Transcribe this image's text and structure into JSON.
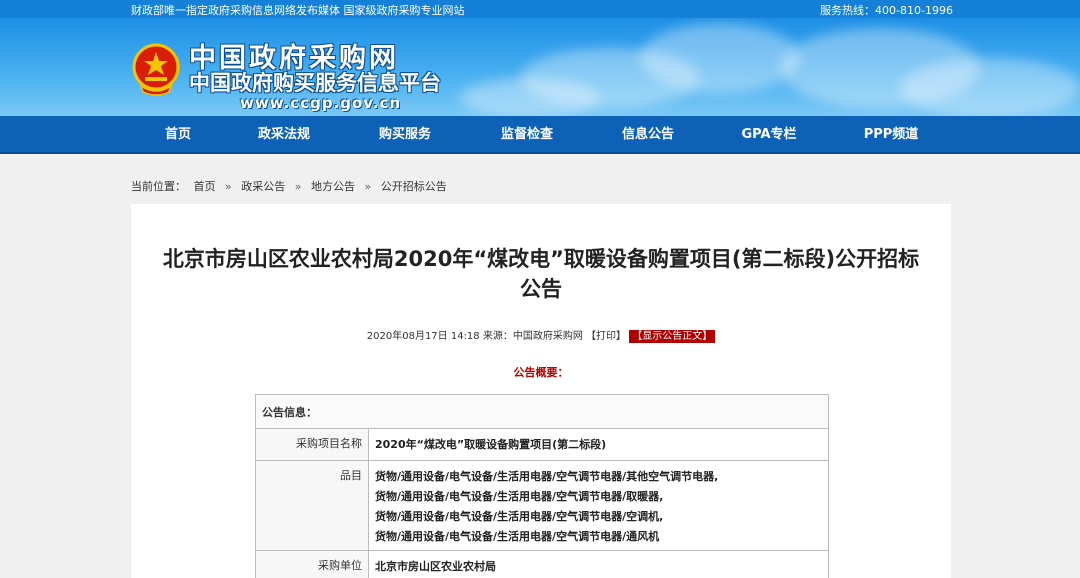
{
  "topbar": {
    "left_text": "财政部唯一指定政府采购信息网络发布媒体  国家级政府采购专业网站",
    "hotline": "服务热线：400-810-1996"
  },
  "header": {
    "title": "中国政府采购网",
    "subtitle": "中国政府购买服务信息平台",
    "url": "www.ccgp.gov.cn"
  },
  "nav": {
    "items": [
      "首页",
      "政采法规",
      "购买服务",
      "监督检查",
      "信息公告",
      "GPA专栏",
      "PPP频道"
    ]
  },
  "breadcrumb": {
    "label": "当前位置：",
    "items": [
      "首页",
      "政采公告",
      "地方公告",
      "公开招标公告"
    ],
    "separator": "»"
  },
  "article": {
    "title_line1": "北京市房山区农业农村局2020年“煤改电”取暖设备购置项目(第二标段)公开招标",
    "title_line2": "公告",
    "date": "2020年08月17日  14:18",
    "source": "来源：中国政府采购网",
    "print": "【打印】",
    "show_text": "【显示公告正文】",
    "summary_heading": "公告概要："
  },
  "info_table": {
    "heading": "公告信息：",
    "rows": [
      {
        "label": "采购项目名称",
        "value": "2020年“煤改电”取暖设备购置项目(第二标段)"
      },
      {
        "label": "品目",
        "values": [
          "货物/通用设备/电气设备/生活用电器/空气调节电器/其他空气调节电器,",
          "货物/通用设备/电气设备/生活用电器/空气调节电器/取暖器,",
          "货物/通用设备/电气设备/生活用电器/空气调节电器/空调机,",
          "货物/通用设备/电气设备/生活用电器/空气调节电器/通风机"
        ]
      },
      {
        "label": "采购单位",
        "value": "北京市房山区农业农村局"
      }
    ]
  },
  "colors": {
    "nav_bg": "#0d62b8",
    "accent_red": "#b00000",
    "header_blue": "#1d8fe6"
  }
}
